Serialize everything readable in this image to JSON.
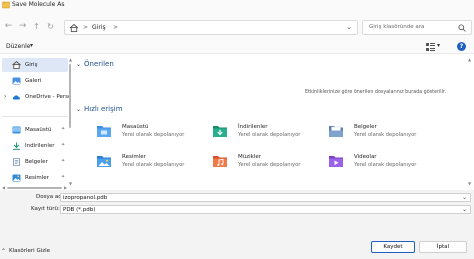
{
  "window": {
    "title": "Save Molecule As",
    "icon": "app-icon"
  },
  "address": {
    "breadcrumb": [
      "Giriş"
    ],
    "separator": ">",
    "search_placeholder": "Giriş klasöründe ara"
  },
  "commandbar": {
    "organize_label": "Düzenle"
  },
  "sidebar": {
    "items": [
      {
        "label": "Giriş",
        "icon": "home-icon",
        "selected": true
      },
      {
        "label": "Galeri",
        "icon": "gallery-icon"
      },
      {
        "label": "OneDrive - Perso",
        "icon": "cloud-icon",
        "expandable": true
      },
      {
        "label": "Masaüstü",
        "icon": "desktop-icon",
        "pinned": true
      },
      {
        "label": "İndirilenler",
        "icon": "download-icon",
        "pinned": true
      },
      {
        "label": "Belgeler",
        "icon": "documents-icon",
        "pinned": true
      },
      {
        "label": "Resimler",
        "icon": "pictures-icon",
        "pinned": true
      }
    ]
  },
  "main": {
    "recommended": {
      "title": "Önerilen",
      "empty_message": "Etkinliklerinize göre önerilen dosyalarınız burada gösterilir."
    },
    "quick_access": {
      "title": "Hızlı erişim",
      "items": [
        {
          "name": "Masaüstü",
          "subtitle": "Yerel olarak depolanıyor",
          "icon": "desktop-folder-icon",
          "color": "#3b8fe0"
        },
        {
          "name": "İndirilenler",
          "subtitle": "Yerel olarak depolanıyor",
          "icon": "downloads-folder-icon",
          "color": "#1e9a7a"
        },
        {
          "name": "Belgeler",
          "subtitle": "Yerel olarak depolanıyor",
          "icon": "documents-folder-icon",
          "color": "#6c8fb8"
        },
        {
          "name": "Resimler",
          "subtitle": "Yerel olarak depolanıyor",
          "icon": "pictures-folder-icon",
          "color": "#2f8be0"
        },
        {
          "name": "Müzikler",
          "subtitle": "Yerel olarak depolanıyor",
          "icon": "music-folder-icon",
          "color": "#e2593b"
        },
        {
          "name": "Videolar",
          "subtitle": "Yerel olarak depolanıyor",
          "icon": "videos-folder-icon",
          "color": "#8a4fd6"
        }
      ]
    }
  },
  "form": {
    "filename_label": "Dosya adı:",
    "filename_value": "izopropanol.pdb",
    "filetype_label": "Kayıt türü:",
    "filetype_value": "PDB (*.pdb)",
    "hide_folders_label": "Klasörleri Gizle",
    "save_label": "Kaydet",
    "cancel_label": "İptal"
  },
  "colors": {
    "accent": "#1f5fbf",
    "section_heading": "#1f4e8c",
    "selected_bg": "#dde7f5"
  }
}
